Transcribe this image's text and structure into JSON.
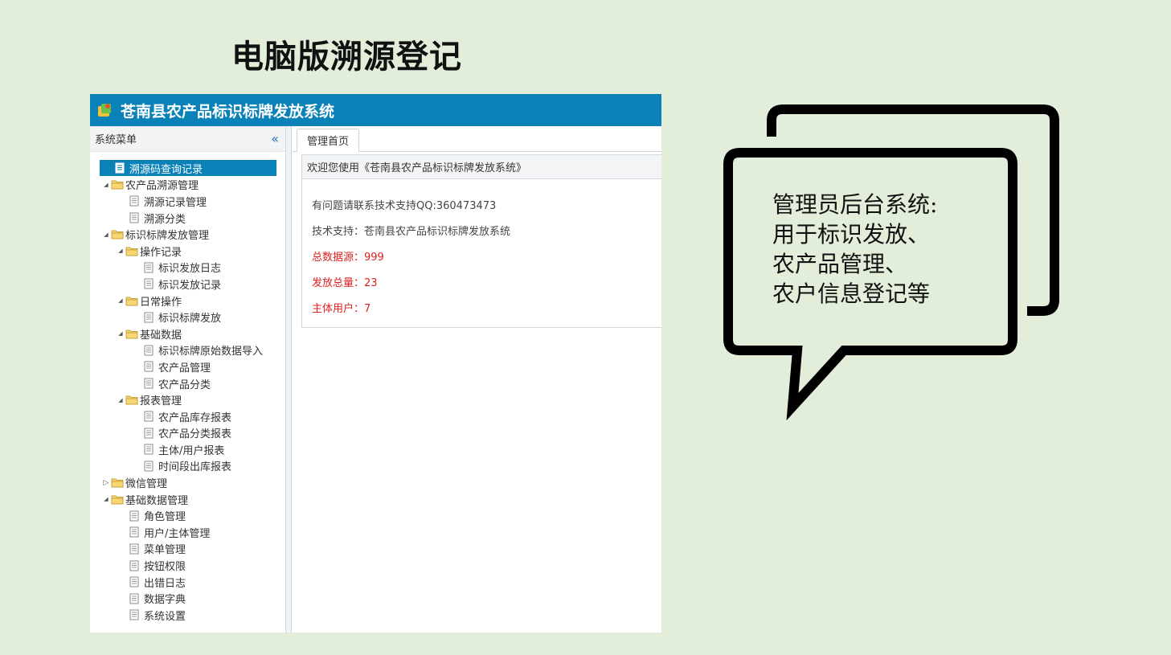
{
  "slide_title": "电脑版溯源登记",
  "app": {
    "title": "苍南县农产品标识标牌发放系统",
    "sidebar": {
      "header": "系统菜单",
      "collapse_glyph": "«",
      "items": [
        {
          "label": "溯源码查询记录",
          "type": "leaf",
          "level": 0,
          "selected": true
        },
        {
          "label": "农产品溯源管理",
          "type": "folder",
          "level": 0,
          "expanded": true
        },
        {
          "label": "溯源记录管理",
          "type": "leaf",
          "level": 1
        },
        {
          "label": "溯源分类",
          "type": "leaf",
          "level": 1
        },
        {
          "label": "标识标牌发放管理",
          "type": "folder",
          "level": 0,
          "expanded": true
        },
        {
          "label": "操作记录",
          "type": "folder",
          "level": 1,
          "expanded": true
        },
        {
          "label": "标识发放日志",
          "type": "leaf",
          "level": 2
        },
        {
          "label": "标识发放记录",
          "type": "leaf",
          "level": 2
        },
        {
          "label": "日常操作",
          "type": "folder",
          "level": 1,
          "expanded": true
        },
        {
          "label": "标识标牌发放",
          "type": "leaf",
          "level": 2
        },
        {
          "label": "基础数据",
          "type": "folder",
          "level": 1,
          "expanded": true
        },
        {
          "label": "标识标牌原始数据导入",
          "type": "leaf",
          "level": 2
        },
        {
          "label": "农产品管理",
          "type": "leaf",
          "level": 2
        },
        {
          "label": "农产品分类",
          "type": "leaf",
          "level": 2
        },
        {
          "label": "报表管理",
          "type": "folder",
          "level": 1,
          "expanded": true
        },
        {
          "label": "农产品库存报表",
          "type": "leaf",
          "level": 2
        },
        {
          "label": "农产品分类报表",
          "type": "leaf",
          "level": 2
        },
        {
          "label": "主体/用户报表",
          "type": "leaf",
          "level": 2
        },
        {
          "label": "时间段出库报表",
          "type": "leaf",
          "level": 2
        },
        {
          "label": "微信管理",
          "type": "folder",
          "level": 0,
          "expanded": false
        },
        {
          "label": "基础数据管理",
          "type": "folder",
          "level": 0,
          "expanded": true
        },
        {
          "label": "角色管理",
          "type": "leaf",
          "level": 1
        },
        {
          "label": "用户/主体管理",
          "type": "leaf",
          "level": 1
        },
        {
          "label": "菜单管理",
          "type": "leaf",
          "level": 1
        },
        {
          "label": "按钮权限",
          "type": "leaf",
          "level": 1
        },
        {
          "label": "出错日志",
          "type": "leaf",
          "level": 1
        },
        {
          "label": "数据字典",
          "type": "leaf",
          "level": 1
        },
        {
          "label": "系统设置",
          "type": "leaf",
          "level": 1
        }
      ]
    },
    "tab": {
      "label": "管理首页"
    },
    "panel": {
      "title": "欢迎您使用《苍南县农产品标识标牌发放系统》",
      "support_line": "有问题请联系技术支持QQ:360473473",
      "tech_line": "技术支持：苍南县农产品标识标牌发放系统",
      "total_sources": "总数据源：999",
      "total_issued": "发放总量：23",
      "entity_users": "主体用户：7"
    }
  },
  "bubble": {
    "lines": [
      "管理员后台系统:",
      "用于标识发放、",
      "农产品管理、",
      "农户信息登记等"
    ]
  },
  "colors": {
    "background": "#e2eed9",
    "header_blue": "#0a82b8",
    "alert_red": "#e02020"
  }
}
